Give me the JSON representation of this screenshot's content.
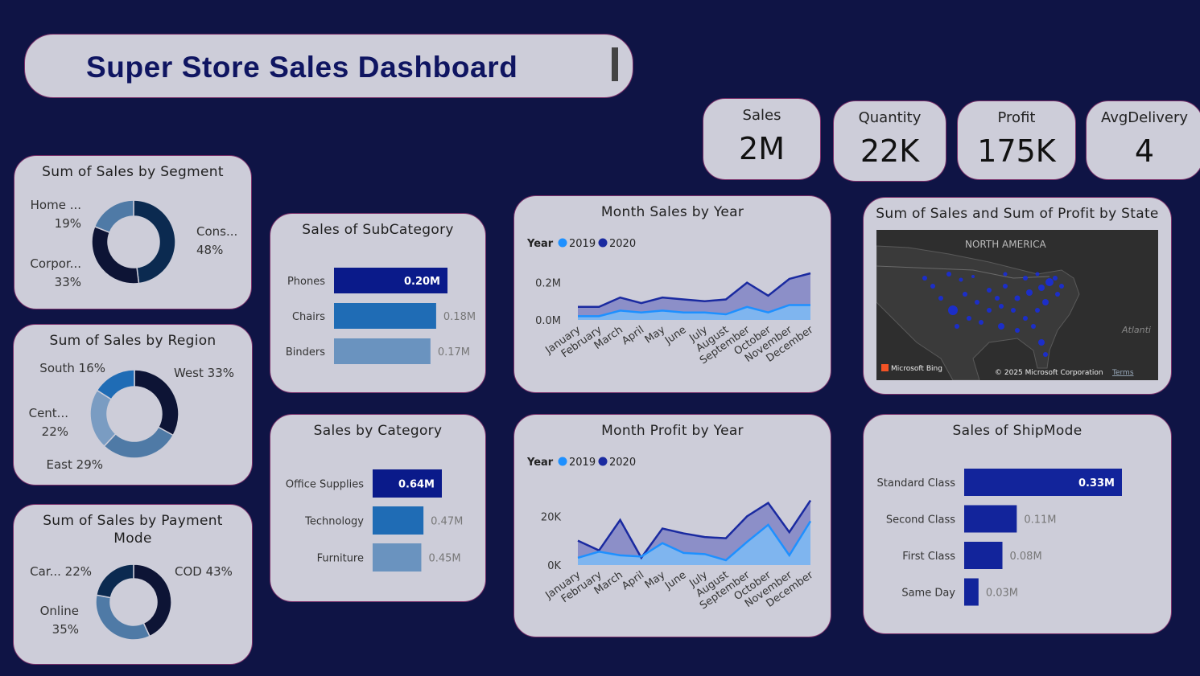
{
  "header": {
    "title": "Super Store Sales Dashboard"
  },
  "kpis": [
    {
      "label": "Sales",
      "value": "2M"
    },
    {
      "label": "Quantity",
      "value": "22K"
    },
    {
      "label": "Profit",
      "value": "175K"
    },
    {
      "label": "AvgDelivery",
      "value": "4"
    }
  ],
  "map": {
    "title": "Sum of Sales and Sum of Profit by State",
    "region_label": "NORTH AMERICA",
    "ocean_label": "Atlanti",
    "bing_label": "Microsoft Bing",
    "copyright": "© 2025 Microsoft Corporation",
    "terms": "Terms"
  },
  "chart_data": [
    {
      "id": "segment",
      "type": "pie",
      "title": "Sum of Sales by Segment",
      "labels": [
        "Cons...",
        "Corpor...",
        "Home ..."
      ],
      "percents": [
        "48%",
        "33%",
        "19%"
      ],
      "values": [
        48,
        33,
        19
      ],
      "colors": [
        "#0b2a50",
        "#0d1435",
        "#4f7aa6"
      ]
    },
    {
      "id": "region",
      "type": "pie",
      "title": "Sum of Sales by Region",
      "labels": [
        "West 33%",
        "East 29%",
        "Cent...",
        "South 16%"
      ],
      "percents": [
        "",
        "",
        "22%",
        ""
      ],
      "values": [
        33,
        29,
        22,
        16
      ],
      "colors": [
        "#0d1435",
        "#4f7aa6",
        "#7a9cc2",
        "#1f6cb5"
      ]
    },
    {
      "id": "payment",
      "type": "pie",
      "title_lines": [
        "Sum of Sales by Payment",
        "Mode"
      ],
      "labels": [
        "COD 43%",
        "Online",
        "Car... 22%"
      ],
      "percents": [
        "",
        "35%",
        ""
      ],
      "values": [
        43,
        35,
        22
      ],
      "colors": [
        "#0d1435",
        "#4f7aa6",
        "#0b2a50"
      ]
    },
    {
      "id": "subcategory",
      "type": "bar",
      "title": "Sales of SubCategory",
      "categories": [
        "Phones",
        "Chairs",
        "Binders"
      ],
      "values": [
        0.2,
        0.18,
        0.17
      ],
      "labels": [
        "0.20M",
        "0.18M",
        "0.17M"
      ],
      "colors": [
        "#0a1a8a",
        "#1f6cb5",
        "#6a93bf"
      ]
    },
    {
      "id": "category",
      "type": "bar",
      "title": "Sales by Category",
      "categories": [
        "Office Supplies",
        "Technology",
        "Furniture"
      ],
      "values": [
        0.64,
        0.47,
        0.45
      ],
      "labels": [
        "0.64M",
        "0.47M",
        "0.45M"
      ],
      "colors": [
        "#0a1a8a",
        "#1f6cb5",
        "#6a93bf"
      ]
    },
    {
      "id": "shipmode",
      "type": "bar",
      "title": "Sales of ShipMode",
      "categories": [
        "Standard Class",
        "Second Class",
        "First Class",
        "Same Day"
      ],
      "values": [
        0.33,
        0.11,
        0.08,
        0.03
      ],
      "labels": [
        "0.33M",
        "0.11M",
        "0.08M",
        "0.03M"
      ],
      "colors": [
        "#12249b",
        "#12249b",
        "#12249b",
        "#12249b"
      ]
    },
    {
      "id": "month_sales",
      "type": "area",
      "title": "Month Sales by Year",
      "legend_title": "Year",
      "x": [
        "January",
        "February",
        "March",
        "April",
        "May",
        "June",
        "July",
        "August",
        "September",
        "October",
        "November",
        "December"
      ],
      "yticks": [
        "0.0M",
        "0.2M"
      ],
      "ylim": [
        0,
        0.25
      ],
      "series": [
        {
          "name": "2019",
          "color": "#1e90ff",
          "values": [
            0.02,
            0.02,
            0.05,
            0.04,
            0.05,
            0.04,
            0.04,
            0.03,
            0.07,
            0.04,
            0.08,
            0.08
          ]
        },
        {
          "name": "2020",
          "color": "#1a2aa0",
          "values": [
            0.07,
            0.07,
            0.12,
            0.09,
            0.12,
            0.11,
            0.1,
            0.11,
            0.2,
            0.13,
            0.22,
            0.25
          ]
        }
      ]
    },
    {
      "id": "month_profit",
      "type": "area",
      "title": "Month Profit by Year",
      "legend_title": "Year",
      "x": [
        "January",
        "February",
        "March",
        "April",
        "May",
        "June",
        "July",
        "August",
        "September",
        "October",
        "November",
        "December"
      ],
      "yticks": [
        "0K",
        "20K"
      ],
      "ylim": [
        0,
        30000
      ],
      "series": [
        {
          "name": "2019",
          "color": "#1e90ff",
          "values": [
            3000,
            5500,
            4000,
            3500,
            9000,
            5000,
            4500,
            2000,
            9500,
            16500,
            4000,
            18000
          ]
        },
        {
          "name": "2020",
          "color": "#1a2aa0",
          "values": [
            10000,
            6000,
            18500,
            3000,
            15000,
            13000,
            11500,
            11000,
            20000,
            25500,
            13500,
            26500
          ]
        }
      ]
    }
  ]
}
